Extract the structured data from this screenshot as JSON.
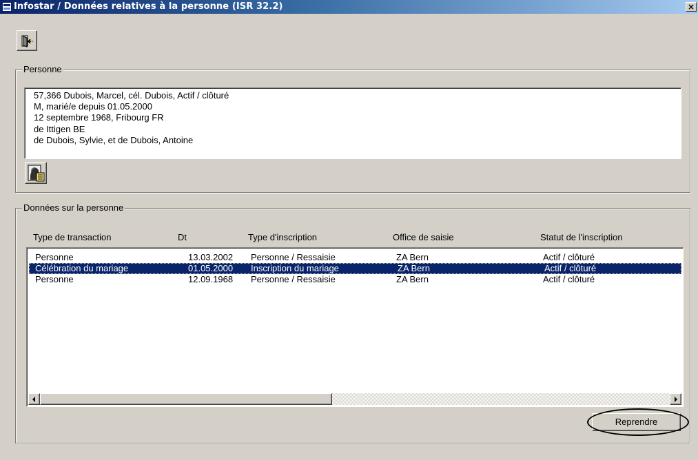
{
  "window": {
    "title": "Infostar / Données relatives à la personne (ISR 32.2)",
    "close_label": "×",
    "app_icon": "app-window-icon"
  },
  "toolbar": {
    "exit_icon": "exit-door-icon"
  },
  "personne": {
    "legend": "Personne",
    "lines": [
      "57,366  Dubois, Marcel, cél. Dubois, Actif / clôturé",
      "M, marié/e depuis 01.05.2000",
      "12 septembre 1968, Fribourg FR",
      "de Ittigen BE",
      "de Dubois, Sylvie, et de Dubois, Antoine"
    ],
    "photo_icon": "person-photo-icon"
  },
  "donnees": {
    "legend": "Données sur la personne",
    "columns": [
      "Type de transaction",
      "Dt",
      "Type d'inscription",
      "Office de saisie",
      "Statut de l'inscription"
    ],
    "rows": [
      [
        "Personne",
        "13.03.2002",
        "Personne / Ressaisie",
        "ZA Bern",
        "Actif / clôturé"
      ],
      [
        "Célébration du mariage",
        "01.05.2000",
        "Inscription du mariage",
        "ZA Bern",
        "Actif / clôturé"
      ],
      [
        "Personne",
        "12.09.1968",
        "Personne / Ressaisie",
        "ZA Bern",
        "Actif / clôturé"
      ]
    ],
    "selected_row": 1
  },
  "buttons": {
    "reprendre": "Reprendre"
  },
  "colors": {
    "title_start": "#0a246a",
    "title_end": "#a6caf0",
    "selection": "#0a246a",
    "face": "#d4d0c8"
  }
}
